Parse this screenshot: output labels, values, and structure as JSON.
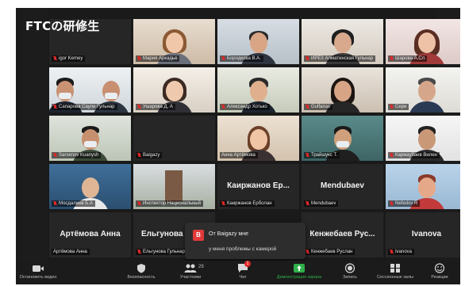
{
  "screen_title": "FTCの研修生",
  "participants": [
    {
      "id": "p1",
      "label": "igor Kemey",
      "kind": "dark"
    },
    {
      "id": "p2",
      "label": "Мария Аркадье",
      "kind": "video",
      "active": true
    },
    {
      "id": "p3",
      "label": "Бородкова В.А.",
      "kind": "video"
    },
    {
      "id": "p4",
      "label": "ИРЕЗ Алматинская Гульнар",
      "kind": "video"
    },
    {
      "id": "p5",
      "label": "Шарова А.Сл",
      "kind": "video"
    },
    {
      "id": "p6",
      "label": "Сапарова Сауле Гульнар",
      "kind": "video"
    },
    {
      "id": "p7",
      "label": "Ушарова Д. А",
      "kind": "video"
    },
    {
      "id": "p8",
      "label": "Александр Хотько",
      "kind": "video"
    },
    {
      "id": "p9",
      "label": "Gulfairas",
      "kind": "video"
    },
    {
      "id": "p10",
      "label": "Сери",
      "kind": "video"
    },
    {
      "id": "p11",
      "label": "Sarsenov Kuanysh",
      "kind": "video"
    },
    {
      "id": "p12",
      "label": "Baigazy",
      "kind": "dark"
    },
    {
      "id": "p13",
      "label": "Анна Артёмова",
      "kind": "video"
    },
    {
      "id": "p14",
      "label": "Трайшукс Т.",
      "kind": "video"
    },
    {
      "id": "p15",
      "label": "Каржаубаев Вилен",
      "kind": "video"
    },
    {
      "id": "p16",
      "label": "Мосдалиев Б.А",
      "kind": "video"
    },
    {
      "id": "p17",
      "label": "Инспектор Национальный",
      "kind": "video"
    },
    {
      "id": "p18",
      "label": "Каиржанов Ерболан",
      "display": "Каиржанов  Ер...",
      "kind": "name"
    },
    {
      "id": "p19",
      "label": "Mendubaev",
      "display": "Mendubaev",
      "kind": "name"
    },
    {
      "id": "p20",
      "label": "Nefedov R",
      "kind": "video"
    },
    {
      "id": "p21",
      "label": "Артёмова Анна",
      "display": "Артёмова Анна",
      "kind": "name"
    },
    {
      "id": "p22",
      "label": "Ельгунова Гульнар",
      "display": "Ельгунова",
      "kind": "name"
    },
    {
      "id": "p23",
      "label": "Кенжебаев Руслан",
      "display": "Кенжебаев  Рус...",
      "kind": "name"
    },
    {
      "id": "p24",
      "label": "Ivanova",
      "display": "Ivanova",
      "kind": "name"
    }
  ],
  "chat": {
    "avatar_letter": "B",
    "from": "От Baigazy мне",
    "message": "у меня проблемы с камерой"
  },
  "toolbar": {
    "stop_video": "Остановить видео",
    "security": "Безопасность",
    "participants": "Участники",
    "participants_count": "29",
    "chat": "Чат",
    "chat_badge": "1",
    "share": "Демонстрация экрана",
    "record": "Запись",
    "rooms": "Сессионные залы",
    "reactions": "Реакции"
  },
  "colors": {
    "active_border": "#c9d63b",
    "share_green": "#2fb04a",
    "mic_off_red": "#e02828"
  }
}
